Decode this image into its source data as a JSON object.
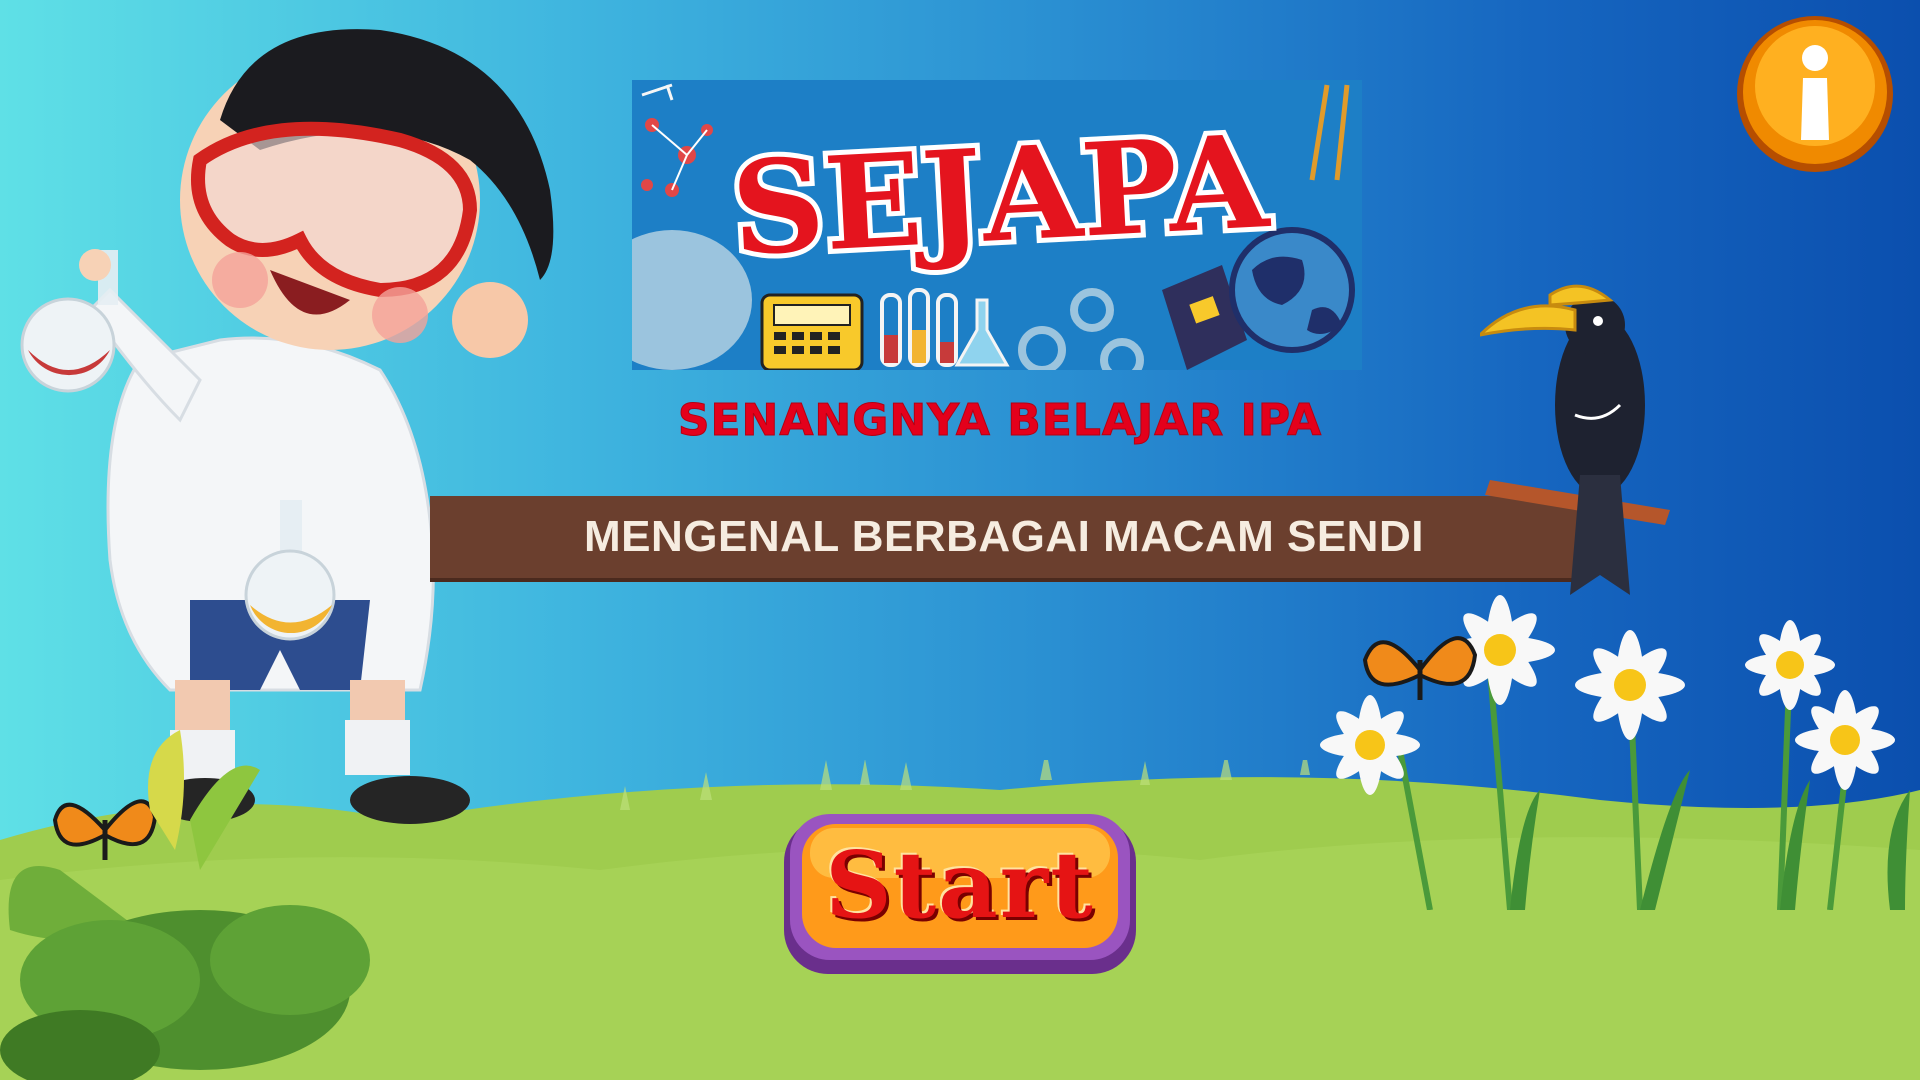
{
  "app": {
    "logo_text": "SEJAPA",
    "subtitle": "SENANGNYA BELAJAR IPA",
    "topic_title": "MENGENAL BERBAGAI MACAM SENDI",
    "start_label": "Start"
  },
  "colors": {
    "sky_left": "#5fe0e6",
    "sky_right": "#0b4fae",
    "grass": "#9fcc4e",
    "ribbon": "#6b3f2e",
    "subtitle_red": "#e4001b",
    "start_orange": "#ff9a1a",
    "start_purple": "#7b3fa0",
    "info_orange": "#f08a00"
  },
  "icons": {
    "info": "info-icon",
    "start": "start-button-graphic"
  }
}
